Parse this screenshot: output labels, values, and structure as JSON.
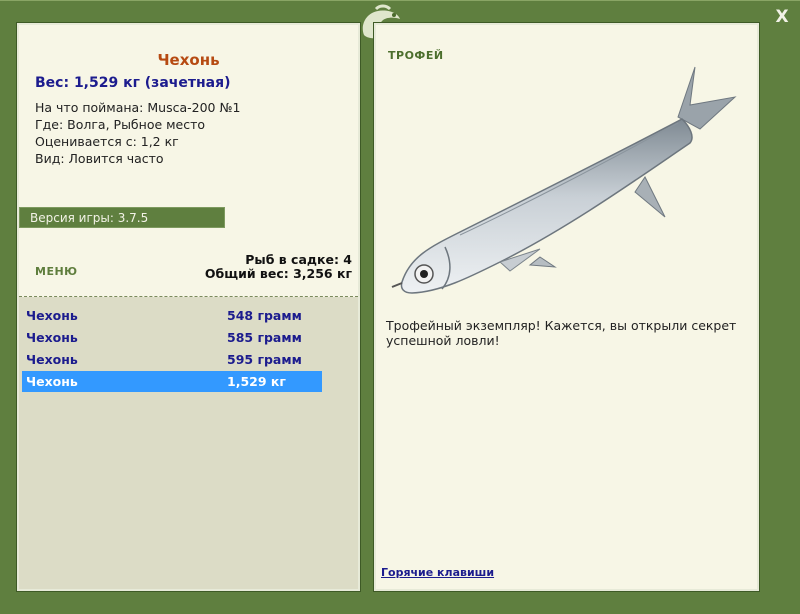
{
  "fish": {
    "name": "Чехонь",
    "weight_line": "Вес: 1,529 кг (зачетная)",
    "caught_on": "На что поймана: Musca-200 №1",
    "location": "Где: Волга, Рыбное место",
    "rated_from": "Оценивается с: 1,2 кг",
    "species_info": "Вид: Ловится часто"
  },
  "version": "Версия игры: 3.7.5",
  "menu_label": "МЕНЮ",
  "net": {
    "count_line": "Рыб в садке: 4",
    "total_line": "Общий вес: 3,256 кг"
  },
  "catch_list": [
    {
      "name": "Чехонь",
      "weight": "548 грамм"
    },
    {
      "name": "Чехонь",
      "weight": "585 грамм"
    },
    {
      "name": "Чехонь",
      "weight": "595 грамм"
    },
    {
      "name": "Чехонь",
      "weight": "1,529 кг"
    }
  ],
  "selected_index": 3,
  "trophy": {
    "label": "ТРОФЕЙ",
    "text": "Трофейный экземпляр! Кажется, вы открыли секрет успешной ловли!"
  },
  "hotkeys_link": "Горячие клавиши",
  "close_label": "X",
  "colors": {
    "frame": "#5f7f3f",
    "panel": "#f7f6e6",
    "fish_name": "#b64a12",
    "link_blue": "#1c1c8e",
    "selection": "#3399ff"
  }
}
